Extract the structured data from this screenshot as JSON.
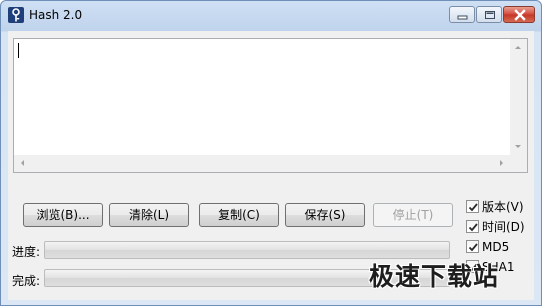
{
  "window": {
    "title": "Hash 2.0"
  },
  "icons": {
    "app": "key-icon",
    "minimize": "minimize-icon",
    "maximize": "maximize-icon",
    "close": "close-icon"
  },
  "editor": {
    "content": ""
  },
  "buttons": {
    "browse": "浏览(B)...",
    "clear": "清除(L)",
    "copy": "复制(C)",
    "save": "保存(S)",
    "stop": "停止(T)"
  },
  "options": [
    {
      "label": "版本(V)",
      "checked": true
    },
    {
      "label": "时间(D)",
      "checked": true
    },
    {
      "label": "MD5",
      "checked": true
    },
    {
      "label": "SHA1",
      "checked": true
    }
  ],
  "progress": {
    "file_label": "进度:",
    "file_value": 0,
    "total_label": "完成:",
    "total_value": 0
  },
  "watermark": {
    "text": "极速下载站"
  },
  "colors": {
    "close_button": "#c43524",
    "progress_fill": "#06b025",
    "checkmark": "#2a2a2a"
  }
}
